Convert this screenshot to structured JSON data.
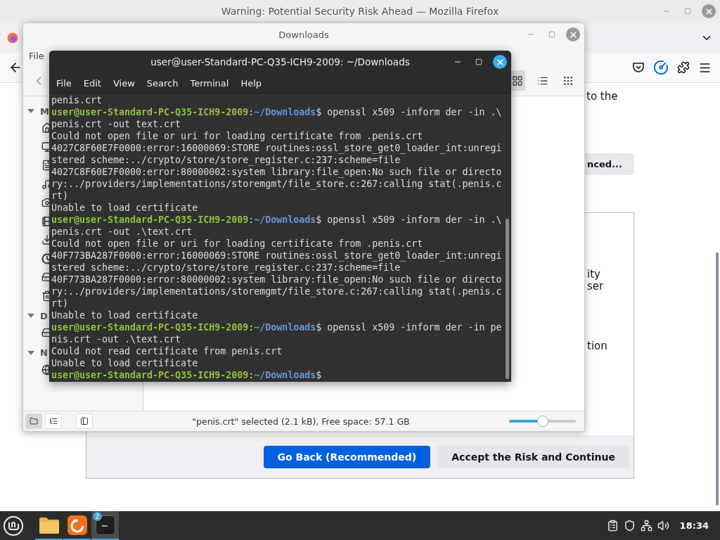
{
  "firefox": {
    "title": "Warning: Potential Security Risk Ahead — Mozilla Firefox",
    "page": {
      "intro_fragment": "to the",
      "advanced_button": "nced...",
      "panel_paragraphs": [
        {
          "lines": [
            "ity",
            "ser"
          ]
        },
        {
          "lines": [
            "tion"
          ]
        }
      ],
      "buttons": [
        {
          "label": "Go Back (Recommended)",
          "primary": true
        },
        {
          "label": "Accept the Risk and Continue",
          "primary": false
        }
      ]
    }
  },
  "file_manager": {
    "title": "Downloads",
    "menu": [
      "File"
    ],
    "view_buttons": [
      {
        "kind": "icons",
        "selected": true
      },
      {
        "kind": "list",
        "selected": false
      },
      {
        "kind": "compact",
        "selected": false
      }
    ],
    "sidebar": [
      {
        "label": "M",
        "expanded": true,
        "items": [
          {
            "kind": "home"
          },
          {
            "kind": "desktop"
          },
          {
            "kind": "documents"
          },
          {
            "kind": "music"
          },
          {
            "kind": "pictures"
          },
          {
            "kind": "videos"
          },
          {
            "kind": "downloads"
          },
          {
            "kind": "recent"
          },
          {
            "kind": "computer"
          },
          {
            "kind": "trash"
          }
        ]
      },
      {
        "label": "D",
        "expanded": true,
        "items": [
          {
            "kind": "drive"
          }
        ]
      },
      {
        "label": "N",
        "expanded": true,
        "items": [
          {
            "kind": "network"
          }
        ]
      }
    ],
    "status_bar": {
      "pane_buttons": [
        {
          "kind": "places",
          "selected": true
        },
        {
          "kind": "tree",
          "selected": false
        },
        {
          "kind": "toggle",
          "selected": false
        }
      ],
      "text": "\"penis.crt\" selected (2.1 kB), Free space: 57.1 GB",
      "zoom": {
        "level": 0.5
      }
    }
  },
  "terminal": {
    "title": "user@user-Standard-PC-Q35-ICH9-2009: ~/Downloads",
    "menu": [
      "File",
      "Edit",
      "View",
      "Search",
      "Terminal",
      "Help"
    ],
    "lines": [
      {
        "kind": "output",
        "text": "penis.crt"
      },
      {
        "kind": "prompt",
        "user": "user@user-Standard-PC-Q35-ICH9-2009",
        "sep": ":",
        "path": "~/Downloads",
        "command": "$ openssl x509 -inform der -in .\\"
      },
      {
        "kind": "output",
        "text": "penis.crt -out text.crt"
      },
      {
        "kind": "output",
        "text": "Could not open file or uri for loading certificate from .penis.crt"
      },
      {
        "kind": "output",
        "text": "4027C8F60E7F0000:error:16000069:STORE routines:ossl_store_get0_loader_int:unregi"
      },
      {
        "kind": "output",
        "text": "stered scheme:../crypto/store/store_register.c:237:scheme=file"
      },
      {
        "kind": "output",
        "text": "4027C8F60E7F0000:error:80000002:system library:file_open:No such file or directo"
      },
      {
        "kind": "output",
        "text": "ry:../providers/implementations/storemgmt/file_store.c:267:calling stat(.penis.c"
      },
      {
        "kind": "output",
        "text": "rt)"
      },
      {
        "kind": "output",
        "text": "Unable to load certificate"
      },
      {
        "kind": "prompt",
        "user": "user@user-Standard-PC-Q35-ICH9-2009",
        "sep": ":",
        "path": "~/Downloads",
        "command": "$ openssl x509 -inform der -in .\\"
      },
      {
        "kind": "output",
        "text": "penis.crt -out .\\text.crt"
      },
      {
        "kind": "output",
        "text": "Could not open file or uri for loading certificate from .penis.crt"
      },
      {
        "kind": "output",
        "text": "40F773BA287F0000:error:16000069:STORE routines:ossl_store_get0_loader_int:unregi"
      },
      {
        "kind": "output",
        "text": "stered scheme:../crypto/store/store_register.c:237:scheme=file"
      },
      {
        "kind": "output",
        "text": "40F773BA287F0000:error:80000002:system library:file_open:No such file or directo"
      },
      {
        "kind": "output",
        "text": "ry:../providers/implementations/storemgmt/file_store.c:267:calling stat(.penis.c"
      },
      {
        "kind": "output",
        "text": "rt)"
      },
      {
        "kind": "output",
        "text": "Unable to load certificate"
      },
      {
        "kind": "prompt",
        "user": "user@user-Standard-PC-Q35-ICH9-2009",
        "sep": ":",
        "path": "~/Downloads",
        "command": "$ openssl x509 -inform der -in pe"
      },
      {
        "kind": "output",
        "text": "nis.crt -out .\\text.crt"
      },
      {
        "kind": "output",
        "text": "Could not read certificate from penis.crt"
      },
      {
        "kind": "output",
        "text": "Unable to load certificate"
      },
      {
        "kind": "prompt",
        "user": "user@user-Standard-PC-Q35-ICH9-2009",
        "sep": ":",
        "path": "~/Downloads",
        "command": "$"
      }
    ]
  },
  "taskbar": {
    "apps": [
      {
        "kind": "files",
        "active": false
      },
      {
        "kind": "firefox",
        "active": false
      },
      {
        "kind": "terminal",
        "active": true,
        "badge": "2"
      }
    ],
    "tray": [
      {
        "kind": "clipboard"
      },
      {
        "kind": "shield"
      },
      {
        "kind": "network"
      },
      {
        "kind": "volume"
      }
    ],
    "clock": "18:34"
  }
}
